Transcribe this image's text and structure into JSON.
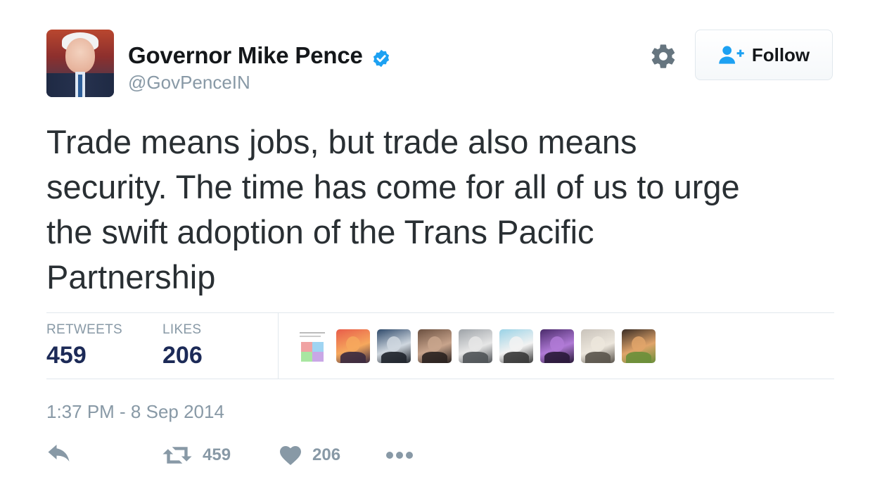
{
  "author": {
    "display_name": "Governor Mike Pence",
    "handle": "@GovPenceIN",
    "verified_icon": "verified-badge-icon"
  },
  "header": {
    "settings_icon": "gear-icon",
    "follow_label": "Follow",
    "follow_icon": "add-user-icon"
  },
  "tweet": {
    "text": "Trade means jobs, but trade also means\nsecurity. The time has come for all of us to urge\nthe swift adoption of the Trans Pacific\nPartnership",
    "timestamp": "1:37 PM - 8 Sep 2014"
  },
  "stats": {
    "retweets_label": "RETWEETS",
    "retweets_value": "459",
    "likes_label": "LIKES",
    "likes_value": "206"
  },
  "likers": [
    {
      "name": "liker-1",
      "colors": [
        "#ffffff",
        "#f0a3a3",
        "#9fd4f2",
        "#a9e6a1",
        "#c9a7e6"
      ]
    },
    {
      "name": "liker-2",
      "colors": [
        "#e85d4a",
        "#f6a85d",
        "#3b2a3f"
      ]
    },
    {
      "name": "liker-3",
      "colors": [
        "#2f4a6b",
        "#cfd7df",
        "#20252c"
      ]
    },
    {
      "name": "liker-4",
      "colors": [
        "#6b5040",
        "#c8a48c",
        "#2a2220"
      ]
    },
    {
      "name": "liker-5",
      "colors": [
        "#9ea3a8",
        "#e6e6e6",
        "#505458"
      ]
    },
    {
      "name": "liker-6",
      "colors": [
        "#9ad2e6",
        "#f2f2f2",
        "#3a3a3a"
      ]
    },
    {
      "name": "liker-7",
      "colors": [
        "#4a2b6b",
        "#b07ad6",
        "#2a1a3a"
      ]
    },
    {
      "name": "liker-8",
      "colors": [
        "#c9c3bb",
        "#ece6dc",
        "#5b554d"
      ]
    },
    {
      "name": "liker-9",
      "colors": [
        "#3a2d25",
        "#e0a46a",
        "#6a8f3a"
      ]
    }
  ],
  "actions": {
    "reply_icon": "reply-icon",
    "retweet_icon": "retweet-icon",
    "retweet_count": "459",
    "like_icon": "heart-icon",
    "like_count": "206",
    "more_icon": "more-dots-icon"
  },
  "colors": {
    "verified_blue": "#1da1f2",
    "follow_icon_blue": "#1da1f2",
    "stat_value": "#1c2a57",
    "muted": "#8899a6",
    "text": "#292f33"
  }
}
